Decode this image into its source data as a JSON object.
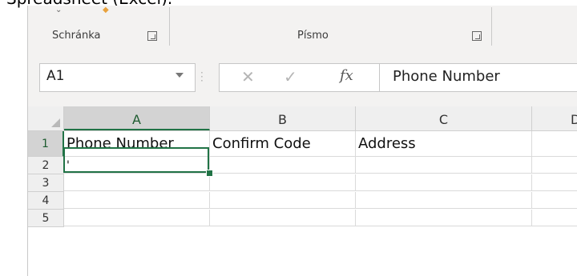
{
  "caption": "Spreadsheet (Excel).",
  "ribbon": {
    "clipboard_label": "Schránka",
    "font_label": "Písmo"
  },
  "name_box": {
    "value": "A1"
  },
  "formula_bar": {
    "value": "Phone Number",
    "fx_symbol": "fx"
  },
  "columns": [
    "A",
    "B",
    "C",
    "D"
  ],
  "rows": [
    {
      "num": "1",
      "cells": [
        "Phone Number",
        "Confirm Code",
        "Address",
        ""
      ]
    },
    {
      "num": "2",
      "cells": [
        "'",
        "",
        "",
        ""
      ]
    },
    {
      "num": "3",
      "cells": [
        "",
        "",
        "",
        ""
      ]
    },
    {
      "num": "4",
      "cells": [
        "",
        "",
        "",
        ""
      ]
    },
    {
      "num": "5",
      "cells": [
        "",
        "",
        "",
        ""
      ]
    }
  ],
  "colors": {
    "accent": "#217346"
  }
}
